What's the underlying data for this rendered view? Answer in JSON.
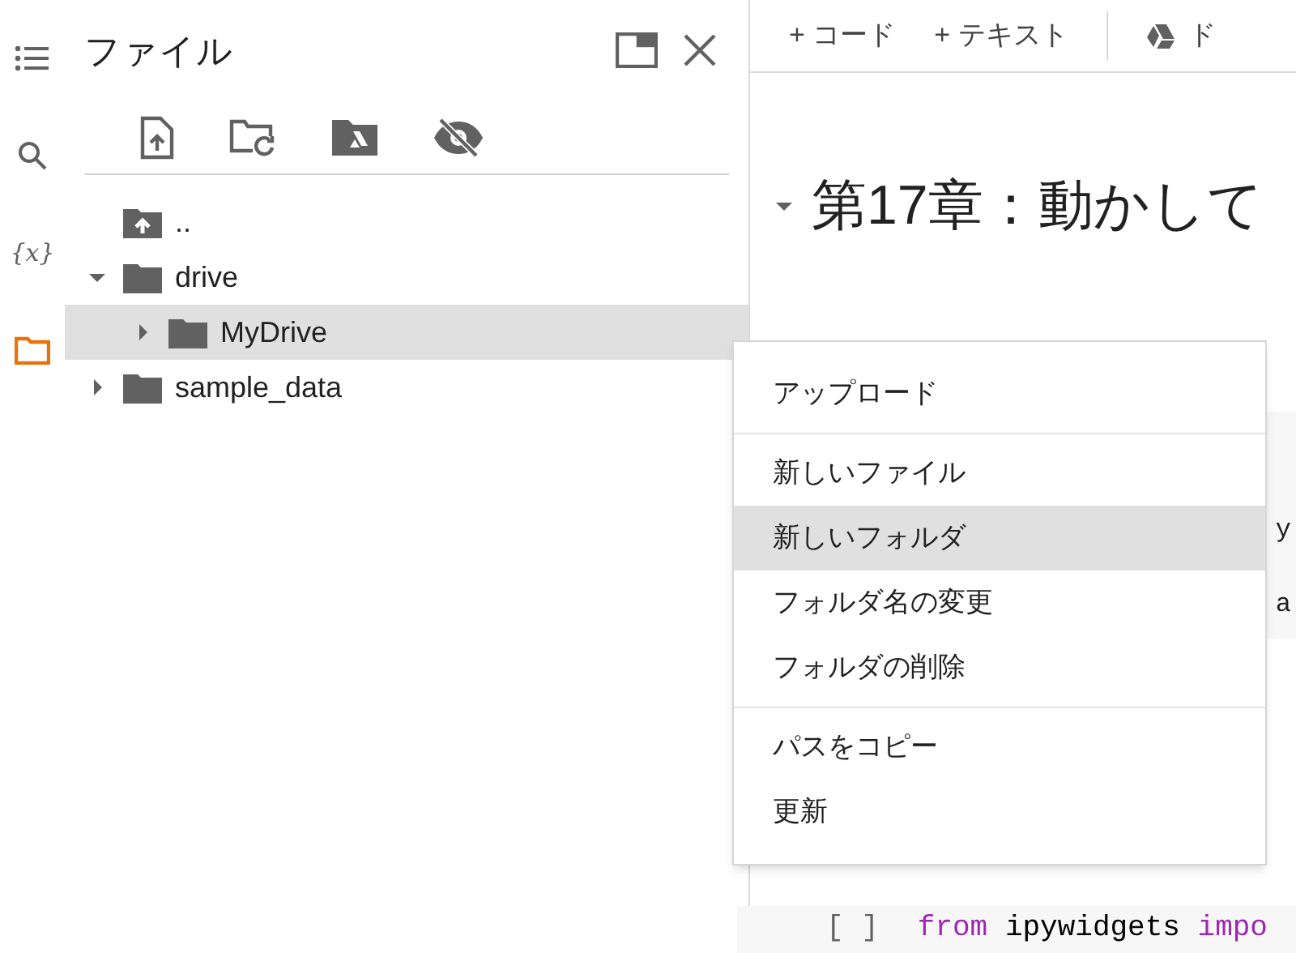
{
  "sidebar_icons": [
    {
      "kind": "toc",
      "selected": false
    },
    {
      "kind": "search",
      "selected": false
    },
    {
      "kind": "variables",
      "label": "{x}",
      "selected": false
    },
    {
      "kind": "files",
      "selected": true
    }
  ],
  "files_panel": {
    "title": "ファイル",
    "toolbar": [
      {
        "kind": "upload"
      },
      {
        "kind": "refresh"
      },
      {
        "kind": "drive"
      },
      {
        "kind": "hide"
      }
    ],
    "tree": [
      {
        "name": "..",
        "kind": "parent",
        "selected": false
      },
      {
        "name": "drive",
        "kind": "folder",
        "expanded": true,
        "selected": false,
        "children": [
          {
            "name": "MyDrive",
            "kind": "folder",
            "expanded": false,
            "selected": true
          }
        ]
      },
      {
        "name": "sample_data",
        "kind": "folder",
        "expanded": false,
        "selected": false
      }
    ]
  },
  "notebook": {
    "toolbar": [
      {
        "kind": "add",
        "label": "+ コード"
      },
      {
        "kind": "add",
        "label": "+ テキスト"
      },
      {
        "kind": "drive",
        "label": "ド"
      }
    ],
    "heading": {
      "text": "第17章：動かして",
      "expanded": true
    },
    "code_fragments": [
      "y",
      "a"
    ],
    "code_line": {
      "prompt": "[ ]",
      "keyword": "from",
      "module": "ipywidgets",
      "keyword2": "impo"
    }
  },
  "context_menu": {
    "groups": [
      [
        {
          "label": "アップロード",
          "selected": false
        }
      ],
      [
        {
          "label": "新しいファイル",
          "selected": false
        },
        {
          "label": "新しいフォルダ",
          "selected": true
        },
        {
          "label": "フォルダ名の変更",
          "selected": false
        },
        {
          "label": "フォルダの削除",
          "selected": false
        }
      ],
      [
        {
          "label": "パスをコピー",
          "selected": false
        },
        {
          "label": "更新",
          "selected": false
        }
      ]
    ]
  }
}
